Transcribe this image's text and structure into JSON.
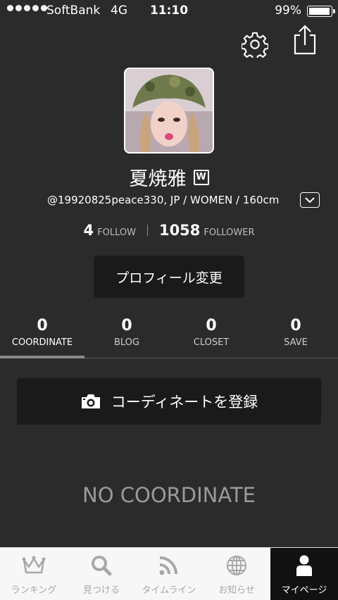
{
  "status_bar": {
    "carrier": "SoftBank",
    "network": "4G",
    "time": "11:10",
    "battery": "99%"
  },
  "profile": {
    "name": "夏焼雅",
    "badge": "W",
    "meta": "@19920825peace330, JP / WOMEN / 160cm",
    "follow_count": "4",
    "follow_label": "FOLLOW",
    "follower_count": "1058",
    "follower_label": "FOLLOWER",
    "edit_label": "プロフィール変更"
  },
  "tabs": [
    {
      "count": "0",
      "label": "COORDINATE"
    },
    {
      "count": "0",
      "label": "BLOG"
    },
    {
      "count": "0",
      "label": "CLOSET"
    },
    {
      "count": "0",
      "label": "SAVE"
    }
  ],
  "register_label": "コーディネートを登録",
  "empty_text": "NO COORDINATE",
  "tabbar": [
    {
      "label": "ランキング",
      "icon": "crown-icon"
    },
    {
      "label": "見つける",
      "icon": "search-icon"
    },
    {
      "label": "タイムライン",
      "icon": "rss-icon"
    },
    {
      "label": "お知らせ",
      "icon": "globe-icon"
    },
    {
      "label": "マイページ",
      "icon": "person-icon"
    }
  ]
}
